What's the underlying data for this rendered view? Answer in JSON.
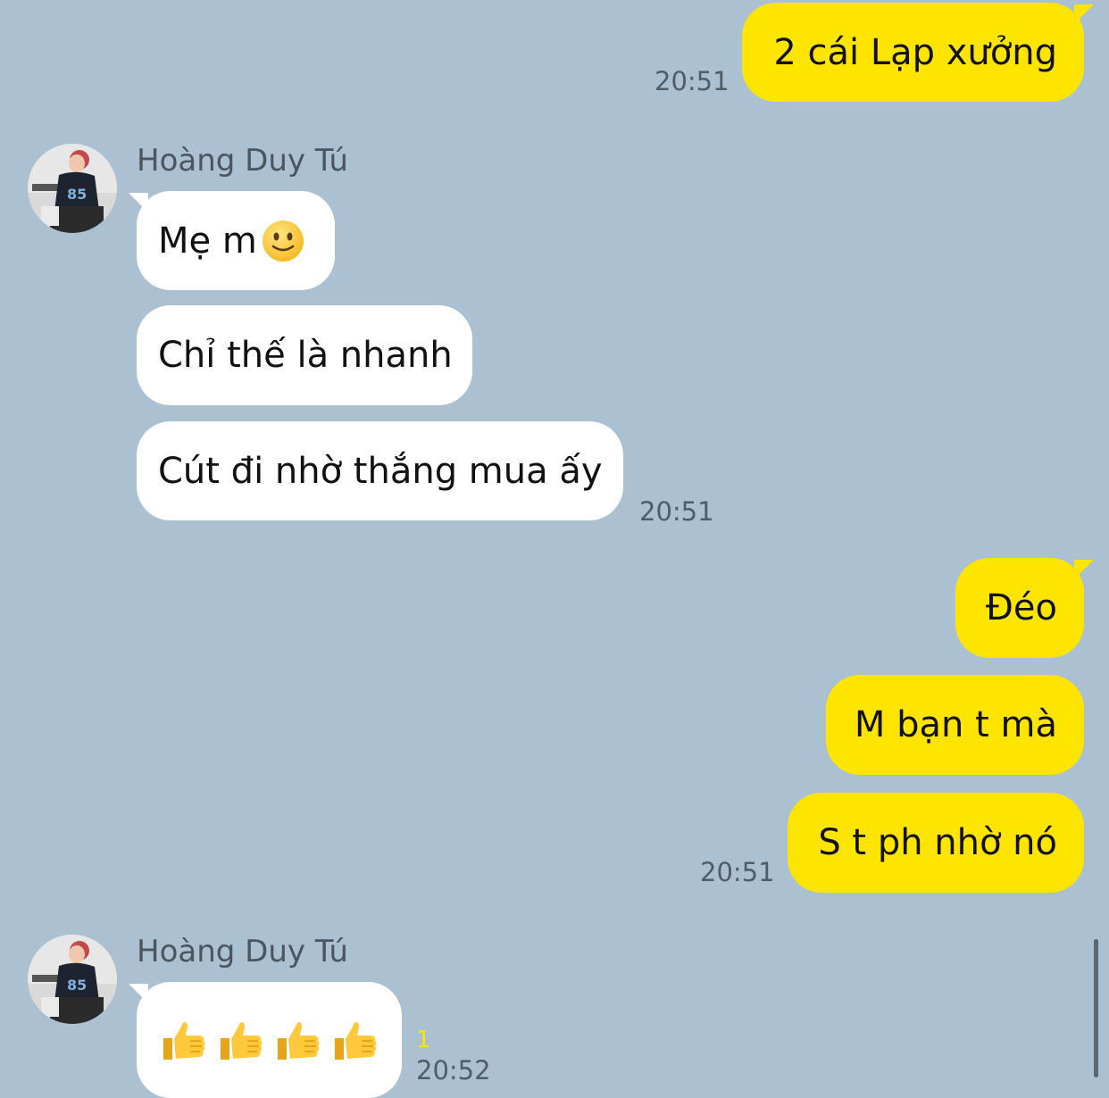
{
  "messages": {
    "m1": {
      "text": "2 cái Lạp xưởng",
      "time": "20:51"
    },
    "sender1": "Hoàng Duy Tú",
    "m2": {
      "text": "Mẹ m"
    },
    "m3": {
      "text": "Chỉ thế là nhanh"
    },
    "m4": {
      "text": "Cút đi nhờ thắng mua ấy",
      "time": "20:51"
    },
    "m5": {
      "text": "Đéo"
    },
    "m6": {
      "text": "M bạn t mà"
    },
    "m7": {
      "text": "S t ph nhờ nó",
      "time": "20:51"
    },
    "sender2": "Hoàng Duy Tú",
    "m8": {
      "unread": "1",
      "time": "20:52"
    }
  },
  "icons": {
    "smile": "slightly-smiling-face-emoji",
    "thumbs": "thumbs-up-emoji"
  },
  "colors": {
    "background": "#abc1d1",
    "sent_bubble": "#fee500",
    "received_bubble": "#ffffff"
  }
}
